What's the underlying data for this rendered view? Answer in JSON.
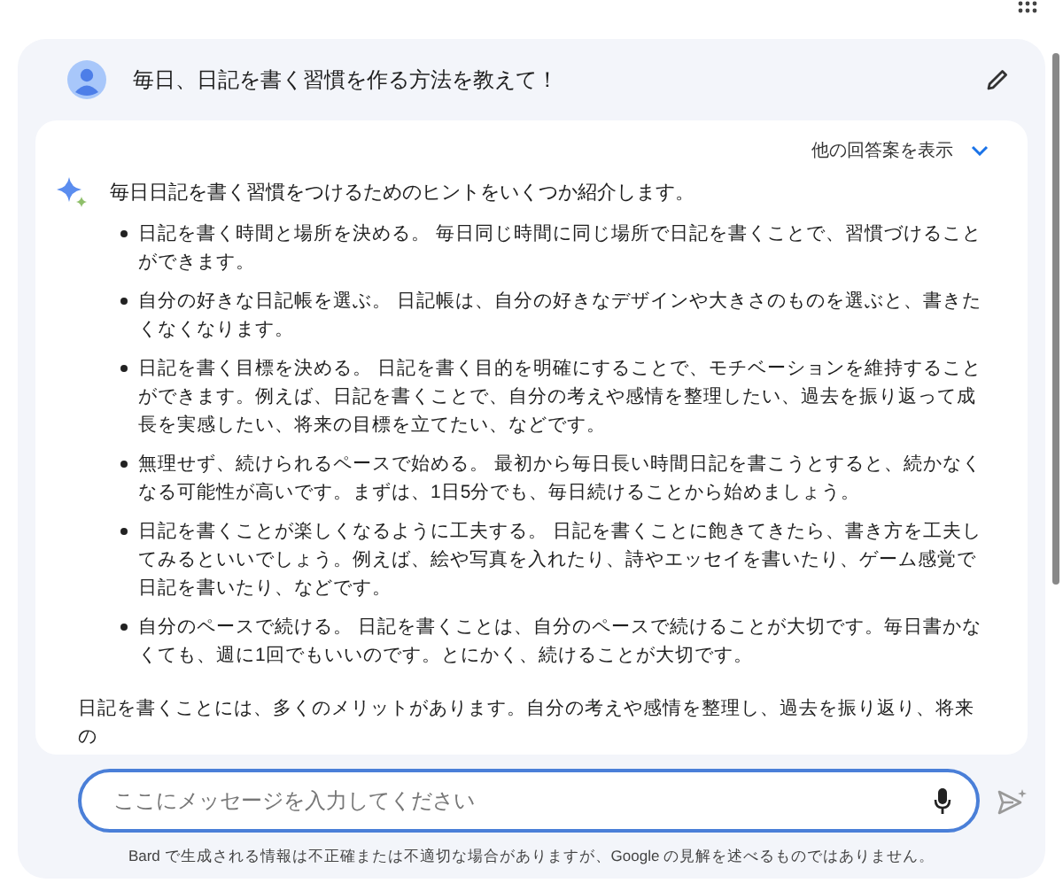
{
  "prompt": {
    "text": "毎日、日記を書く習慣を作る方法を教えて！"
  },
  "response": {
    "drafts_label": "他の回答案を表示",
    "intro": "毎日日記を書く習慣をつけるためのヒントをいくつか紹介します。",
    "tips": [
      "日記を書く時間と場所を決める。 毎日同じ時間に同じ場所で日記を書くことで、習慣づけることができます。",
      "自分の好きな日記帳を選ぶ。 日記帳は、自分の好きなデザインや大きさのものを選ぶと、書きたくなくなります。",
      "日記を書く目標を決める。 日記を書く目的を明確にすることで、モチベーションを維持することができます。例えば、日記を書くことで、自分の考えや感情を整理したい、過去を振り返って成長を実感したい、将来の目標を立てたい、などです。",
      "無理せず、続けられるペースで始める。 最初から毎日長い時間日記を書こうとすると、続かなくなる可能性が高いです。まずは、1日5分でも、毎日続けることから始めましょう。",
      "日記を書くことが楽しくなるように工夫する。 日記を書くことに飽きてきたら、書き方を工夫してみるといいでしょう。例えば、絵や写真を入れたり、詩やエッセイを書いたり、ゲーム感覚で日記を書いたり、などです。",
      "自分のペースで続ける。 日記を書くことは、自分のペースで続けることが大切です。毎日書かなくても、週に1回でもいいのです。とにかく、続けることが大切です。"
    ],
    "closing": "日記を書くことには、多くのメリットがあります。自分の考えや感情を整理し、過去を振り返り、将来の"
  },
  "input": {
    "placeholder": "ここにメッセージを入力してください"
  },
  "disclaimer": "Bard で生成される情報は不正確または不適切な場合がありますが、Google の見解を述べるものではありません。"
}
